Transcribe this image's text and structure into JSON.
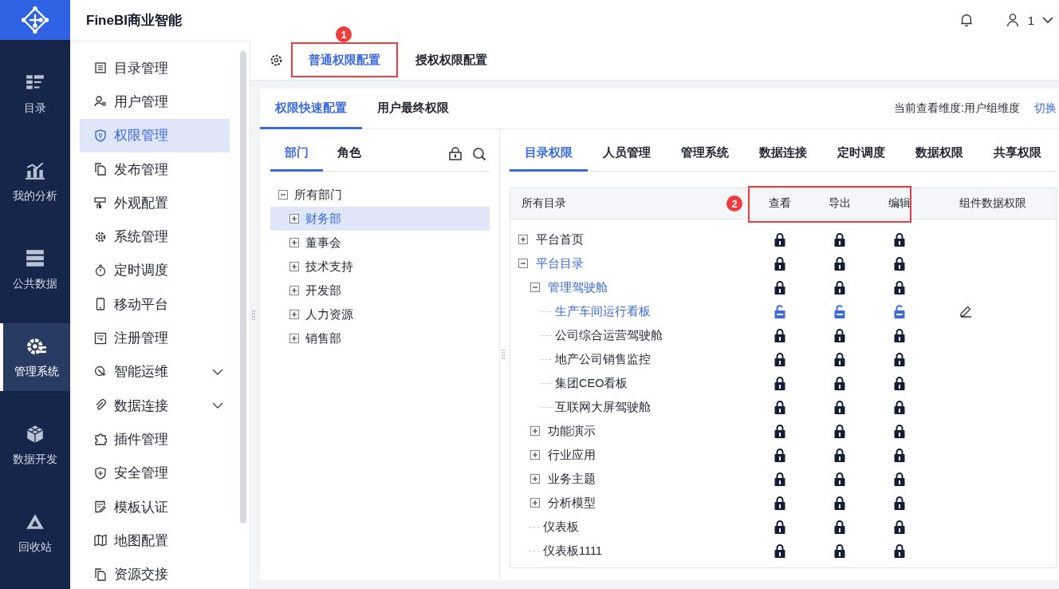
{
  "app": {
    "title": "FineBI商业智能",
    "user": "1"
  },
  "rail": [
    {
      "label": "目录",
      "selected": false
    },
    {
      "label": "我的分析",
      "selected": false
    },
    {
      "label": "公共数据",
      "selected": false
    },
    {
      "label": "管理系统",
      "selected": true
    },
    {
      "label": "数据开发",
      "selected": false
    },
    {
      "label": "回收站",
      "selected": false
    }
  ],
  "menu": [
    {
      "label": "目录管理",
      "selected": false,
      "kind": "item"
    },
    {
      "label": "用户管理",
      "selected": false,
      "kind": "item"
    },
    {
      "label": "权限管理",
      "selected": true,
      "kind": "item"
    },
    {
      "label": "发布管理",
      "selected": false,
      "kind": "item"
    },
    {
      "label": "外观配置",
      "selected": false,
      "kind": "item"
    },
    {
      "label": "系统管理",
      "selected": false,
      "kind": "item"
    },
    {
      "label": "定时调度",
      "selected": false,
      "kind": "item"
    },
    {
      "label": "移动平台",
      "selected": false,
      "kind": "item"
    },
    {
      "label": "注册管理",
      "selected": false,
      "kind": "item"
    },
    {
      "label": "智能运维",
      "selected": false,
      "kind": "group"
    },
    {
      "label": "数据连接",
      "selected": false,
      "kind": "group"
    },
    {
      "label": "插件管理",
      "selected": false,
      "kind": "item"
    },
    {
      "label": "安全管理",
      "selected": false,
      "kind": "item"
    },
    {
      "label": "模板认证",
      "selected": false,
      "kind": "item"
    },
    {
      "label": "地图配置",
      "selected": false,
      "kind": "item"
    },
    {
      "label": "资源交接",
      "selected": false,
      "kind": "item"
    }
  ],
  "top_tabs": [
    {
      "label": "普通权限配置",
      "selected": true,
      "highlighted": true,
      "callout": "1"
    },
    {
      "label": "授权权限配置",
      "selected": false,
      "highlighted": false
    }
  ],
  "sub_tabs": [
    {
      "label": "权限快速配置",
      "selected": true
    },
    {
      "label": "用户最终权限",
      "selected": false
    }
  ],
  "view_info": {
    "text": "当前查看维度:用户组维度",
    "link": "切换"
  },
  "dept_panel": {
    "tabs": [
      {
        "label": "部门",
        "selected": true
      },
      {
        "label": "角色",
        "selected": false
      }
    ],
    "tree": [
      {
        "label": "所有部门",
        "selected": false,
        "expanded": true,
        "children": [
          {
            "label": "财务部",
            "selected": true,
            "expanded": false
          },
          {
            "label": "董事会",
            "selected": false,
            "expanded": false
          },
          {
            "label": "技术支持",
            "selected": false,
            "expanded": false
          },
          {
            "label": "开发部",
            "selected": false,
            "expanded": false
          },
          {
            "label": "人力资源",
            "selected": false,
            "expanded": false
          },
          {
            "label": "销售部",
            "selected": false,
            "expanded": false
          }
        ]
      }
    ]
  },
  "perm_panel": {
    "tabs": [
      {
        "label": "目录权限",
        "selected": true
      },
      {
        "label": "人员管理",
        "selected": false
      },
      {
        "label": "管理系统",
        "selected": false
      },
      {
        "label": "数据连接",
        "selected": false
      },
      {
        "label": "定时调度",
        "selected": false
      },
      {
        "label": "数据权限",
        "selected": false
      },
      {
        "label": "共享权限",
        "selected": false
      }
    ],
    "table": {
      "columns": [
        "所有目录",
        "查看",
        "导出",
        "编辑",
        "组件数据权限"
      ],
      "callout": "2",
      "highlighted_columns": true,
      "rows": [
        {
          "label": "平台首页",
          "kind": "folder",
          "expanded": false,
          "highlighted": false,
          "locked": [
            true,
            true,
            true
          ],
          "editable": false
        },
        {
          "label": "平台目录",
          "kind": "folder",
          "expanded": true,
          "highlighted": true,
          "locked": [
            true,
            true,
            true
          ],
          "editable": false,
          "children": [
            {
              "label": "管理驾驶舱",
              "kind": "folder",
              "expanded": true,
              "highlighted": true,
              "locked": [
                true,
                true,
                true
              ],
              "editable": false,
              "children": [
                {
                  "label": "生产车间运行看板",
                  "kind": "leaf",
                  "highlighted": true,
                  "locked": [
                    false,
                    false,
                    false
                  ],
                  "editable": true
                },
                {
                  "label": "公司综合运营驾驶舱",
                  "kind": "leaf",
                  "highlighted": false,
                  "locked": [
                    true,
                    true,
                    true
                  ],
                  "editable": false
                },
                {
                  "label": "地产公司销售监控",
                  "kind": "leaf",
                  "highlighted": false,
                  "locked": [
                    true,
                    true,
                    true
                  ],
                  "editable": false
                },
                {
                  "label": "集团CEO看板",
                  "kind": "leaf",
                  "highlighted": false,
                  "locked": [
                    true,
                    true,
                    true
                  ],
                  "editable": false
                },
                {
                  "label": "互联网大屏驾驶舱",
                  "kind": "leaf",
                  "highlighted": false,
                  "locked": [
                    true,
                    true,
                    true
                  ],
                  "editable": false
                }
              ]
            },
            {
              "label": "功能演示",
              "kind": "folder",
              "expanded": false,
              "highlighted": false,
              "locked": [
                true,
                true,
                true
              ],
              "editable": false
            },
            {
              "label": "行业应用",
              "kind": "folder",
              "expanded": false,
              "highlighted": false,
              "locked": [
                true,
                true,
                true
              ],
              "editable": false
            },
            {
              "label": "业务主题",
              "kind": "folder",
              "expanded": false,
              "highlighted": false,
              "locked": [
                true,
                true,
                true
              ],
              "editable": false
            },
            {
              "label": "分析模型",
              "kind": "folder",
              "expanded": false,
              "highlighted": false,
              "locked": [
                true,
                true,
                true
              ],
              "editable": false
            },
            {
              "label": "仪表板",
              "kind": "leaf",
              "highlighted": false,
              "locked": [
                true,
                true,
                true
              ],
              "editable": false
            },
            {
              "label": "仪表板1111",
              "kind": "leaf",
              "highlighted": false,
              "locked": [
                true,
                true,
                true
              ],
              "editable": false
            }
          ]
        }
      ]
    }
  }
}
